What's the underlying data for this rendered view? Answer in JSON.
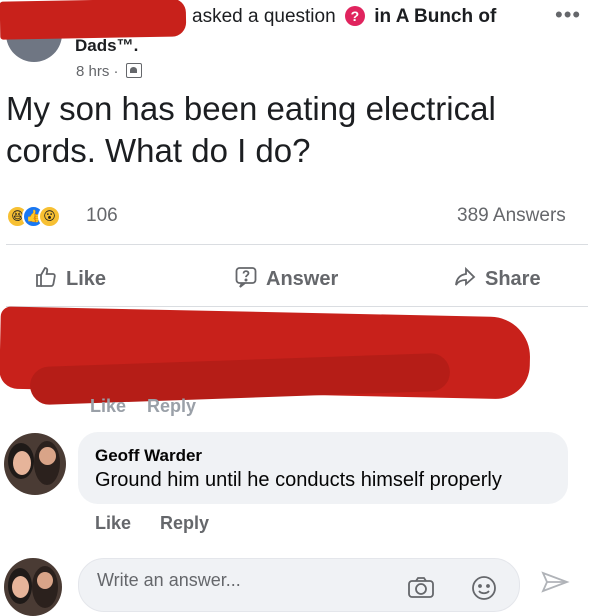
{
  "post": {
    "header": {
      "asked_text": "asked a question",
      "in_text": "in A Bunch of",
      "group_name_tail": "Dads™.",
      "time": "8 hrs ·"
    },
    "question": "My son has been eating electrical cords. What do I do?",
    "reactions": {
      "icons": [
        "haha",
        "like",
        "wow"
      ],
      "count": "106"
    },
    "answers_count": "389 Answers",
    "actions": {
      "like": "Like",
      "answer": "Answer",
      "share": "Share"
    }
  },
  "redacted_comment": {
    "like": "Like",
    "reply": "Reply"
  },
  "comment": {
    "author": "Geoff Warder",
    "text": "Ground him until he conducts himself properly",
    "like": "Like",
    "reply": "Reply"
  },
  "answer_input": {
    "placeholder": "Write an answer..."
  },
  "colors": {
    "redaction": "#c8211b",
    "link_blue": "#1877f2",
    "muted": "#65676b",
    "bubble": "#f0f2f5"
  }
}
